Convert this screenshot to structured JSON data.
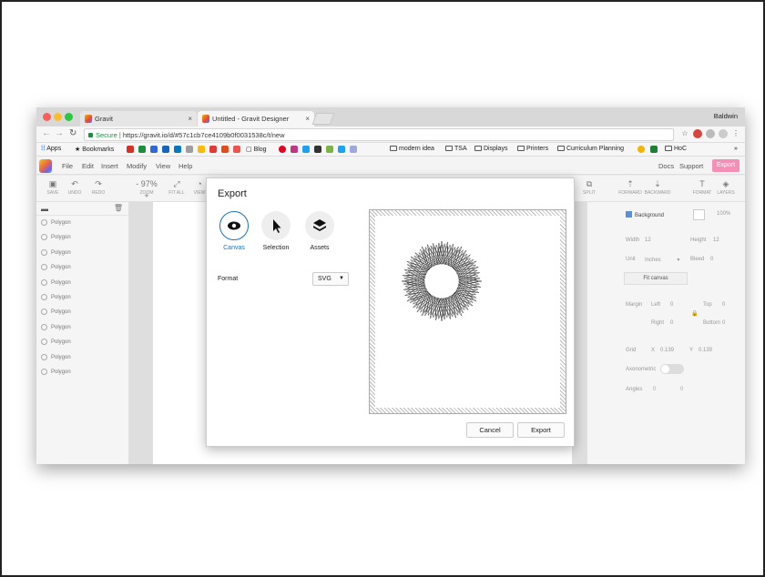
{
  "browser": {
    "tabs": [
      {
        "label": "Gravit"
      },
      {
        "label": "Untitled - Gravit Designer"
      }
    ],
    "user": "Baldwin",
    "address": {
      "secure_label": "Secure",
      "url": "https://gravit.io/d/#57c1cb7ce4109b0f0031538c/t/new"
    },
    "bookmarks": [
      {
        "label": "Apps"
      },
      {
        "label": "Bookmarks"
      },
      {
        "label": "Blog"
      },
      {
        "label": "modern idea"
      },
      {
        "label": "TSA"
      },
      {
        "label": "Displays"
      },
      {
        "label": "Printers"
      },
      {
        "label": "Curriculum Planning"
      },
      {
        "label": "HoC"
      },
      {
        "label": "»"
      }
    ]
  },
  "app": {
    "menu": [
      "File",
      "Edit",
      "Insert",
      "Modify",
      "View",
      "Help"
    ],
    "right_links": [
      "Docs",
      "Support"
    ],
    "export_label": "Export",
    "toolbar": {
      "save": "SAVE",
      "undo": "UNDO",
      "redo": "REDO",
      "zoom": "ZOOM",
      "zoom_value": "97%",
      "fit_all": "FIT ALL",
      "view": "VIEW",
      "split": "SPLIT",
      "forward": "FORWARD",
      "backward": "BACKWARD",
      "format": "FORMAT",
      "layers": "LAYERS"
    },
    "layers": [
      "Polygon",
      "Polygon",
      "Polygon",
      "Polygon",
      "Polygon",
      "Polygon",
      "Polygon",
      "Polygon",
      "Polygon",
      "Polygon",
      "Polygon"
    ]
  },
  "inspector": {
    "background_label": "Background",
    "background_value": "100%",
    "width_label": "Width",
    "width_value": "12",
    "height_label": "Height",
    "height_value": "12",
    "unit_label": "Unit",
    "unit_value": "Inches",
    "bleed_label": "Bleed",
    "bleed_value": "0",
    "fit_canvas": "Fit canvas",
    "margin_label": "Margin",
    "left_label": "Left",
    "left_value": "0",
    "top_label": "Top",
    "top_value": "0",
    "right_label": "Right",
    "right_value": "0",
    "bottom_label": "Bottom",
    "bottom_value": "0",
    "grid_label": "Grid",
    "grid_x_label": "X",
    "grid_x": "0.139",
    "grid_y_label": "Y",
    "grid_y": "0.139",
    "axonometric_label": "Axonometric",
    "angles_label": "Angles",
    "angle1": "0",
    "angle2": "0"
  },
  "dialog": {
    "title": "Export",
    "options": [
      {
        "label": "Canvas",
        "icon": "eye-icon"
      },
      {
        "label": "Selection",
        "icon": "cursor-icon"
      },
      {
        "label": "Assets",
        "icon": "layers-icon"
      }
    ],
    "format_label": "Format",
    "format_value": "SVG",
    "cancel_label": "Cancel",
    "export_label": "Export"
  },
  "colors": {
    "accent": "#1a73b8",
    "export_button": "#f68fb5"
  }
}
